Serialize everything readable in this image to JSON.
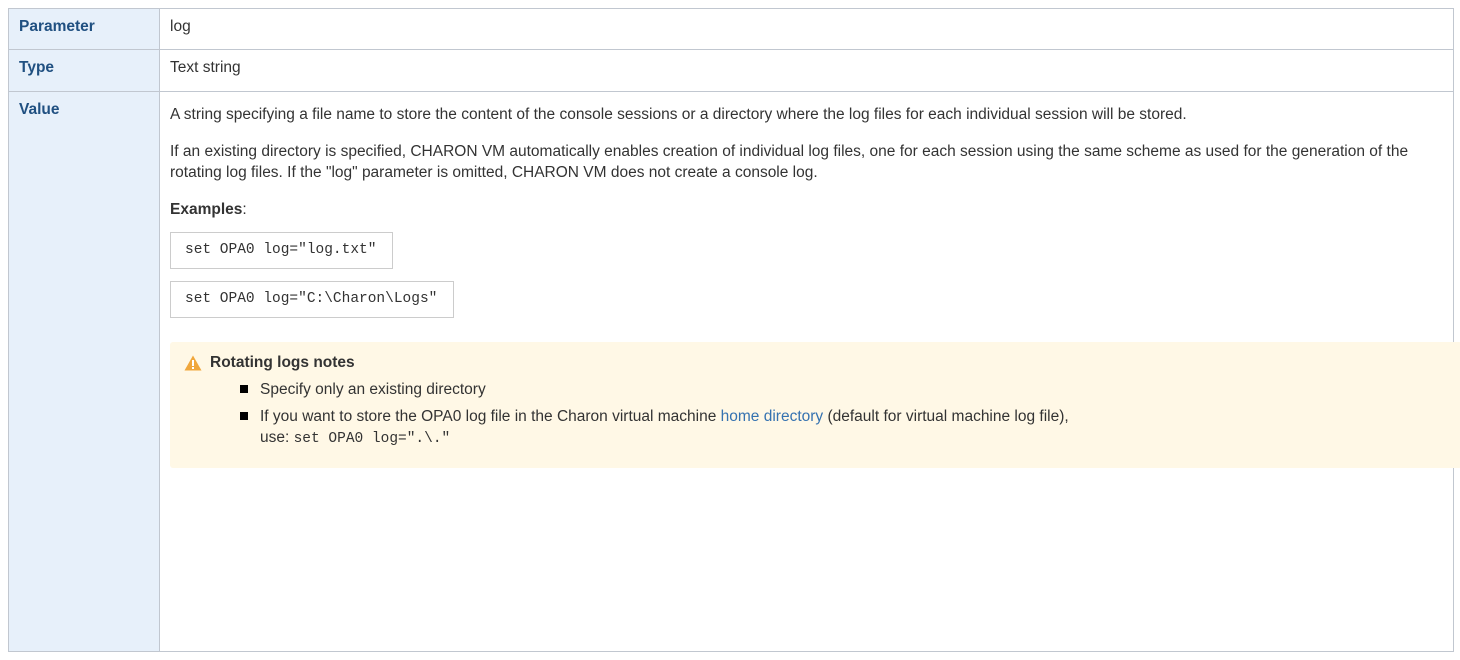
{
  "table": {
    "parameter": {
      "header": "Parameter",
      "value": "log"
    },
    "type": {
      "header": "Type",
      "value": "Text string"
    },
    "value": {
      "header": "Value",
      "paragraph1": "A string specifying a file name to store the content of the console sessions or a directory where the log files for each individual session will be stored.",
      "paragraph2": "If an existing directory is specified, CHARON VM automatically enables creation of individual log files, one for each session using the same scheme as used for the generation of the rotating log files. If the \"log\" parameter is omitted, CHARON VM does not create a console log.",
      "examples_label": "Examples",
      "examples_colon": ":",
      "examples": [
        "set OPA0 log=\"log.txt\"",
        "set OPA0 log=\"C:\\Charon\\Logs\""
      ],
      "note": {
        "icon": "warning-icon",
        "title": "Rotating logs notes",
        "item1": "Specify only an existing directory",
        "item2_before_link": "If you want to store the OPA0 log file in the Charon virtual machine ",
        "item2_link": "home directory",
        "item2_after_link": " (default for virtual machine log file),",
        "item2_use": "use: ",
        "item2_code": "set OPA0 log=\".\\.\""
      }
    }
  },
  "colors": {
    "header_text": "#205081",
    "header_bg": "#e7f0fa",
    "link": "#3572b0",
    "note_bg": "#fff8e6",
    "warning_icon": "#f0a73c",
    "border": "#c1c7d0"
  }
}
